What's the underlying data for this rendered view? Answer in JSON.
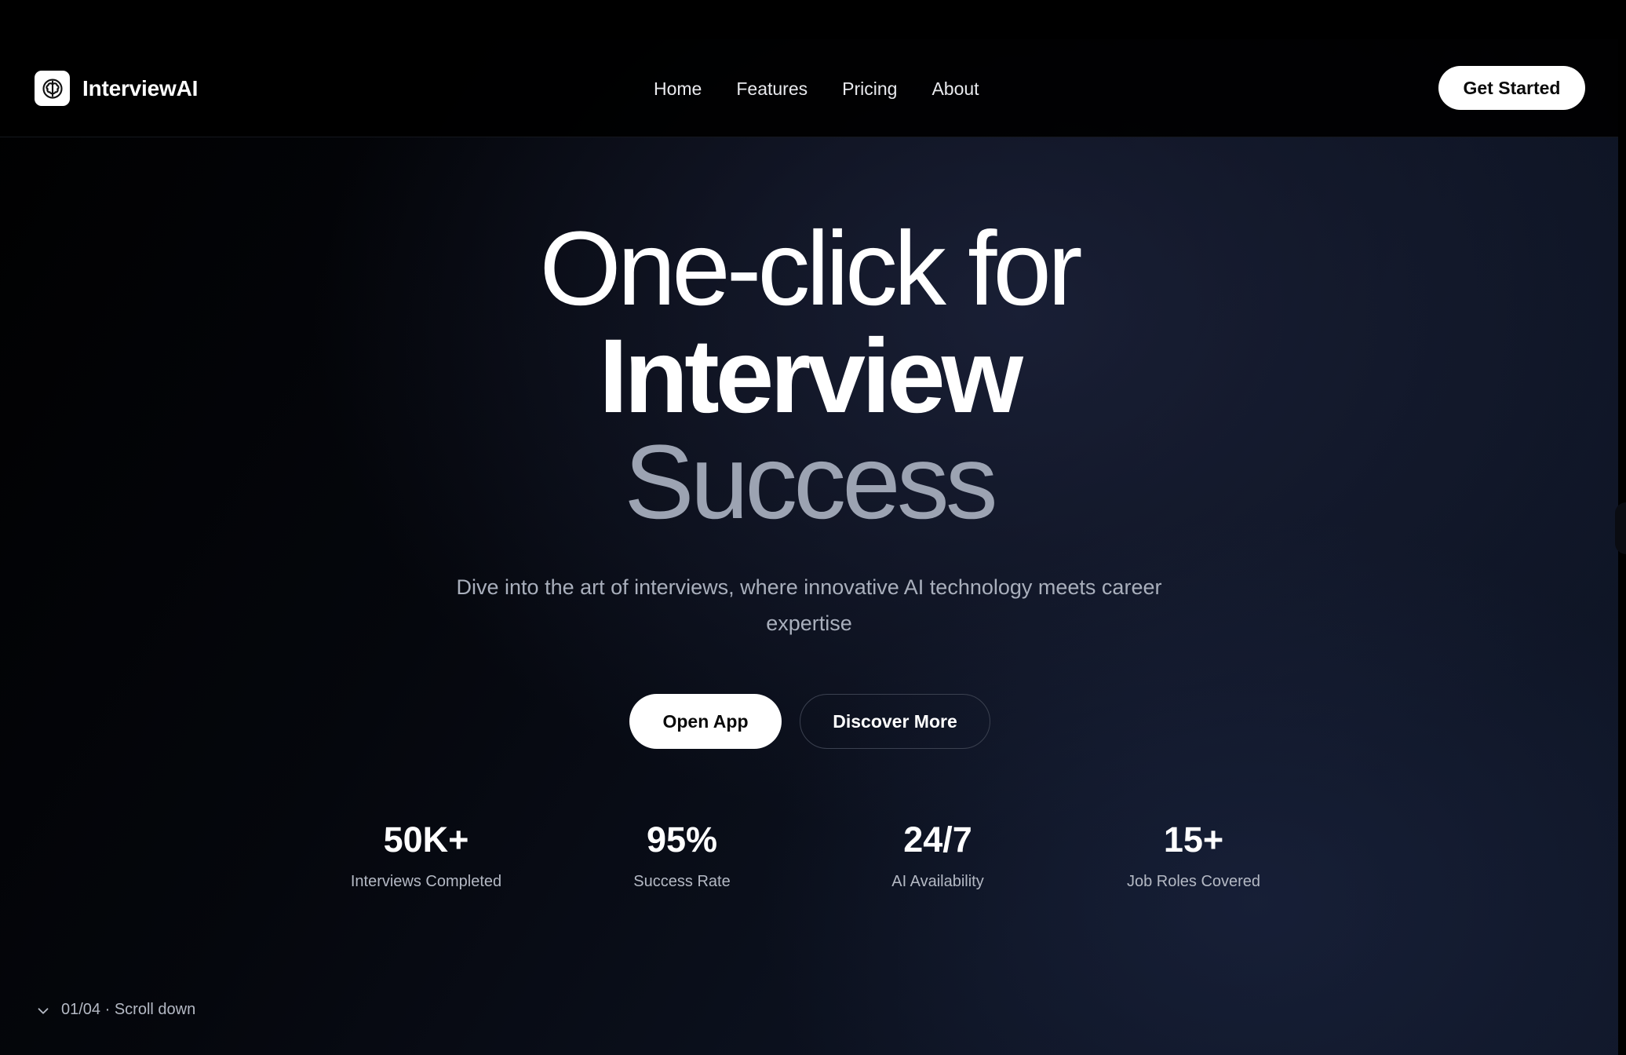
{
  "brand": {
    "name": "InterviewAI",
    "icon": "brain-icon"
  },
  "nav": {
    "items": [
      {
        "label": "Home"
      },
      {
        "label": "Features"
      },
      {
        "label": "Pricing"
      },
      {
        "label": "About"
      }
    ],
    "cta_label": "Get Started"
  },
  "hero": {
    "line1": "One-click for",
    "line2": "Interview",
    "line3": "Success",
    "subtitle": "Dive into the art of interviews, where innovative AI technology meets career expertise",
    "primary_button": "Open App",
    "secondary_button": "Discover More"
  },
  "stats": [
    {
      "value": "50K+",
      "label": "Interviews Completed"
    },
    {
      "value": "95%",
      "label": "Success Rate"
    },
    {
      "value": "24/7",
      "label": "AI Availability"
    },
    {
      "value": "15+",
      "label": "Job Roles Covered"
    }
  ],
  "scroll_hint": {
    "text": "01/04 · Scroll down",
    "icon": "chevron-down-icon"
  },
  "colors": {
    "background": "#000000",
    "accent_muted": "#9ca3b2",
    "button_bg": "#ffffff",
    "button_text": "#0a0a0a"
  }
}
